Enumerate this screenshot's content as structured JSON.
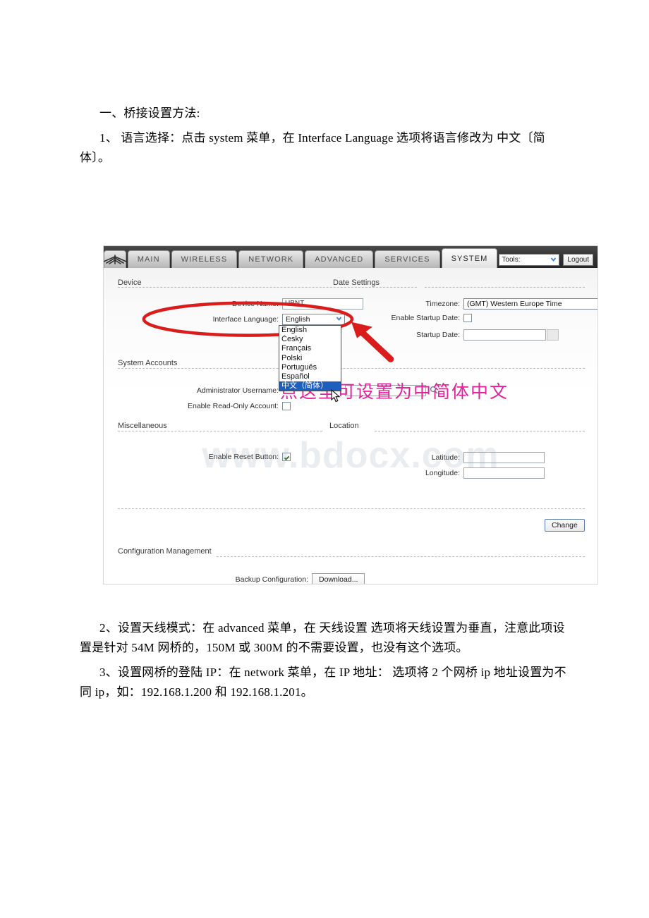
{
  "document": {
    "heading": "一、桥接设置方法:",
    "step1": "1、 语言选择：点击 system 菜单，在 Interface Language 选项将语言修改为 中文〔简体〕。",
    "step2": "2、设置天线模式：在 advanced 菜单，在 天线设置 选项将天线设置为垂直，注意此项设置是针对 54M 网桥的，150M 或 300M 的不需要设置，也没有这个选项。",
    "step3": "3、设置网桥的登陆 IP：在 network 菜单，在 IP 地址： 选项将 2 个网桥 ip 地址设置为不同 ip，如：192.168.1.200 和 192.168.1.201。"
  },
  "screenshot": {
    "watermark": "www.bdocx.com",
    "nav": {
      "logo_name": "ubiquiti-logo",
      "tabs": [
        {
          "label": "MAIN",
          "active": false
        },
        {
          "label": "WIRELESS",
          "active": false
        },
        {
          "label": "NETWORK",
          "active": false
        },
        {
          "label": "ADVANCED",
          "active": false
        },
        {
          "label": "SERVICES",
          "active": false
        },
        {
          "label": "SYSTEM",
          "active": true
        }
      ],
      "tools_label": "Tools:",
      "logout_label": "Logout"
    },
    "sections": {
      "device": "Device",
      "date_settings": "Date Settings",
      "system_accounts": "System Accounts",
      "miscellaneous": "Miscellaneous",
      "location": "Location",
      "configuration_management": "Configuration Management"
    },
    "fields": {
      "device_name_label": "Device Name:",
      "device_name_value": "UBNT",
      "interface_language_label": "Interface Language:",
      "interface_language_value": "English",
      "timezone_label": "Timezone:",
      "timezone_value": "(GMT) Western Europe Time",
      "enable_startup_date_label": "Enable Startup Date:",
      "enable_startup_date_checked": false,
      "startup_date_label": "Startup Date:",
      "startup_date_value": "",
      "administrator_username_label": "Administrator Username:",
      "administrator_username_value": "",
      "enable_readonly_label": "Enable Read-Only Account:",
      "enable_readonly_checked": false,
      "enable_reset_button_label": "Enable Reset Button:",
      "enable_reset_button_checked": true,
      "latitude_label": "Latitude:",
      "latitude_value": "",
      "longitude_label": "Longitude:",
      "longitude_value": "",
      "backup_configuration_label": "Backup Configuration:",
      "download_button_label": "Download...",
      "change_button_label": "Change"
    },
    "language_dropdown": {
      "open": true,
      "options": [
        "English",
        "Česky",
        "Français",
        "Polski",
        "Português",
        "Español",
        "中文（简体）"
      ],
      "selected": "中文（简体）"
    },
    "annotations": {
      "callout_text": "点这里可设置为中简体中文",
      "ellipse_color": "#d91d1d",
      "arrow_color": "#d91d1d",
      "callout_color": "#e2219b"
    }
  }
}
